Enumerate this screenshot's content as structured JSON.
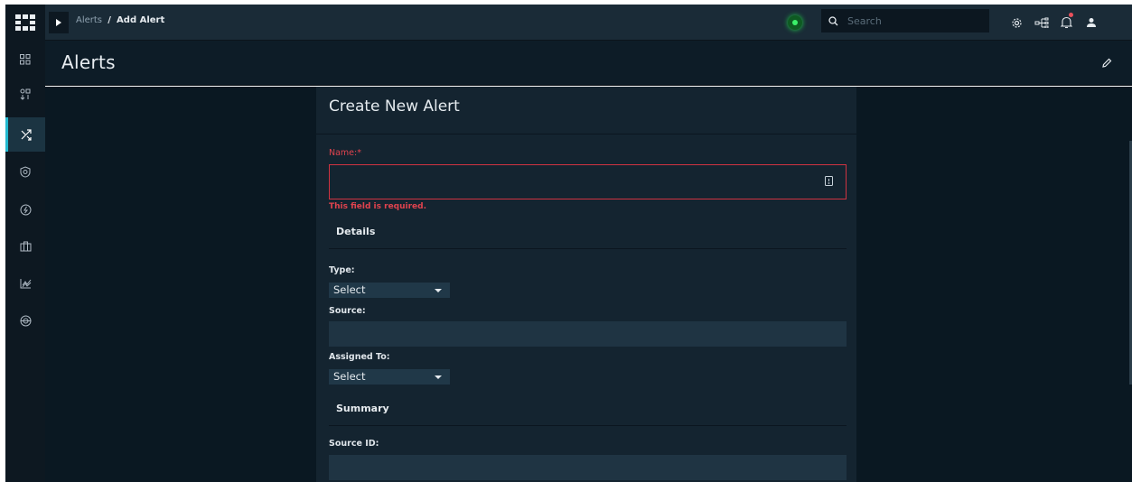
{
  "nav": {
    "items": [
      {
        "icon": "dashboard-icon",
        "label": ""
      },
      {
        "icon": "sort-icon",
        "label": ""
      },
      {
        "icon": "shuffle-icon",
        "label": "",
        "active": true
      },
      {
        "icon": "shield-icon",
        "label": ""
      },
      {
        "icon": "bolt-icon",
        "label": ""
      },
      {
        "icon": "briefcase-icon",
        "label": ""
      },
      {
        "icon": "chart-icon",
        "label": ""
      },
      {
        "icon": "globe-icon",
        "label": ""
      }
    ]
  },
  "topbar": {
    "breadcrumb_parent": "Alerts",
    "breadcrumb_separator": "/",
    "breadcrumb_current": "Add Alert",
    "search_placeholder": "Search",
    "status_color": "#3bf06a",
    "notification_dot_color": "#e8505b"
  },
  "header": {
    "title": "Alerts"
  },
  "form": {
    "title": "Create New Alert",
    "name_label": "Name:",
    "name_required_mark": "*",
    "name_value": "",
    "name_error": "This field is required.",
    "details_heading": "Details",
    "type_label": "Type:",
    "type_value": "Select",
    "source_label": "Source:",
    "source_value": "",
    "assigned_label": "Assigned To:",
    "assigned_value": "Select",
    "summary_heading": "Summary",
    "source_id_label": "Source ID:",
    "source_id_value": ""
  },
  "colors": {
    "accent": "#22b8cf",
    "error": "#e0434e",
    "panel": "#142430",
    "background": "#0a1822"
  }
}
